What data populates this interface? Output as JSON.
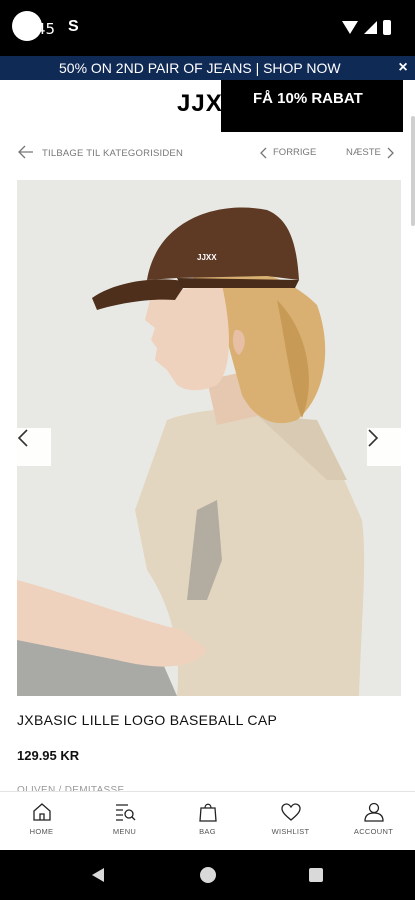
{
  "status_bar": {
    "time": "45",
    "app_glyph": "S"
  },
  "promo": {
    "text": "50% ON 2ND PAIR OF JEANS | SHOP NOW",
    "close_symbol": "×"
  },
  "header": {
    "logo": "JJX",
    "popup_label": "FÅ 10% RABAT"
  },
  "subnav": {
    "back_label": "TILBAGE TIL KATEGORISIDEN",
    "previous_label": "FORRIGE",
    "next_label": "NÆSTE"
  },
  "product": {
    "title": "JXBASIC LILLE LOGO BASEBALL CAP",
    "price": "129.95 KR",
    "color": "OLIVEN / DEMITASSE",
    "cap_logo": "JJXX"
  },
  "bottom_nav": {
    "items": [
      {
        "label": "HOME",
        "icon": "home-icon"
      },
      {
        "label": "MENU",
        "icon": "menu-search-icon"
      },
      {
        "label": "BAG",
        "icon": "bag-icon"
      },
      {
        "label": "WISHLIST",
        "icon": "heart-icon"
      },
      {
        "label": "ACCOUNT",
        "icon": "account-icon"
      }
    ]
  },
  "colors": {
    "promo_bg": "#0f2a55",
    "popup_bg": "#000000",
    "image_bg": "#e8e9e5",
    "cap": "#5e3a24"
  }
}
